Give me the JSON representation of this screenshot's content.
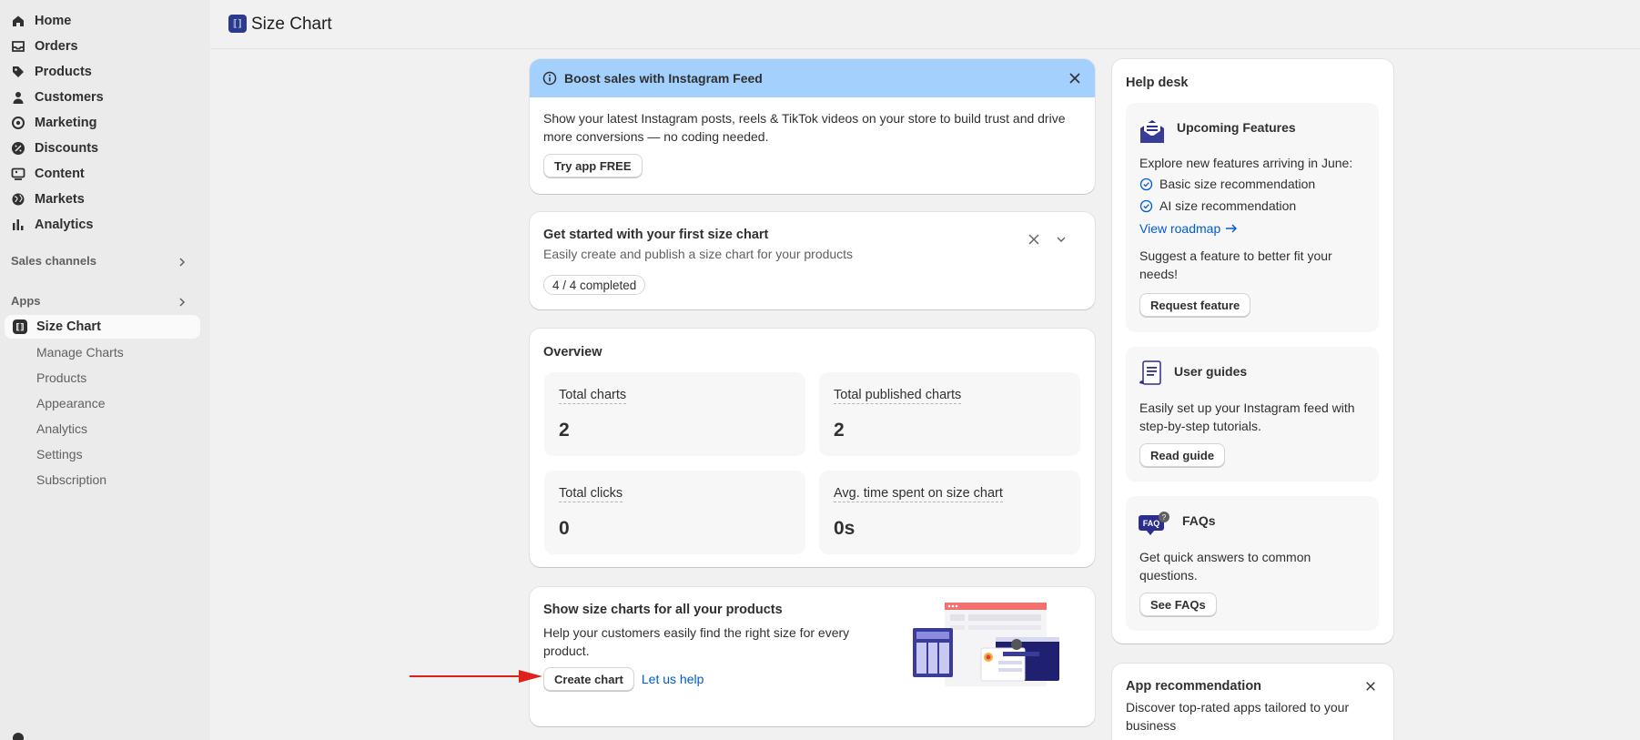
{
  "sidebar": {
    "nav": [
      {
        "label": "Home",
        "icon": "home-icon"
      },
      {
        "label": "Orders",
        "icon": "inbox-icon"
      },
      {
        "label": "Products",
        "icon": "tag-icon"
      },
      {
        "label": "Customers",
        "icon": "person-icon"
      },
      {
        "label": "Marketing",
        "icon": "target-icon"
      },
      {
        "label": "Discounts",
        "icon": "discount-icon"
      },
      {
        "label": "Content",
        "icon": "image-icon"
      },
      {
        "label": "Markets",
        "icon": "globe-icon"
      },
      {
        "label": "Analytics",
        "icon": "bar-chart-icon"
      }
    ],
    "sales_channels_label": "Sales channels",
    "apps_label": "Apps",
    "active_app": "Size Chart",
    "app_subitems": [
      "Manage Charts",
      "Products",
      "Appearance",
      "Analytics",
      "Settings",
      "Subscription"
    ]
  },
  "header": {
    "title": "Size Chart"
  },
  "banner": {
    "title": "Boost sales with Instagram Feed",
    "body": "Show your latest Instagram posts, reels & TikTok videos on your store to build trust and drive more conversions — no coding needed.",
    "button": "Try app FREE"
  },
  "getting_started": {
    "title": "Get started with your first size chart",
    "subtitle": "Easily create and publish a size chart for your products",
    "progress": "4 / 4 completed"
  },
  "overview": {
    "title": "Overview",
    "stats": [
      {
        "label": "Total charts",
        "value": "2"
      },
      {
        "label": "Total published charts",
        "value": "2"
      },
      {
        "label": "Total clicks",
        "value": "0"
      },
      {
        "label": "Avg. time spent on size chart",
        "value": "0s"
      }
    ]
  },
  "promo": {
    "title": "Show size charts for all your products",
    "body": "Help your customers easily find the right size for every product.",
    "primary_button": "Create chart",
    "link": "Let us help"
  },
  "help_desk": {
    "title": "Help desk",
    "upcoming": {
      "title": "Upcoming Features",
      "intro": "Explore new features arriving in June:",
      "items": [
        "Basic size recommendation",
        "AI size recommendation"
      ],
      "roadmap_link": "View roadmap",
      "suggest": "Suggest a feature to better fit your needs!",
      "button": "Request feature"
    },
    "guides": {
      "title": "User guides",
      "body": "Easily set up your Instagram feed with step-by-step tutorials.",
      "button": "Read guide"
    },
    "faqs": {
      "title": "FAQs",
      "badge": "FAQ",
      "body": "Get quick answers to common questions.",
      "button": "See FAQs"
    }
  },
  "app_recommendation": {
    "title": "App recommendation",
    "body": "Discover top-rated apps tailored to your business"
  },
  "colors": {
    "banner_bg": "#a4d0fe",
    "link": "#005bd3",
    "arrow": "#e0201c",
    "brand": "#2b3a8c"
  }
}
